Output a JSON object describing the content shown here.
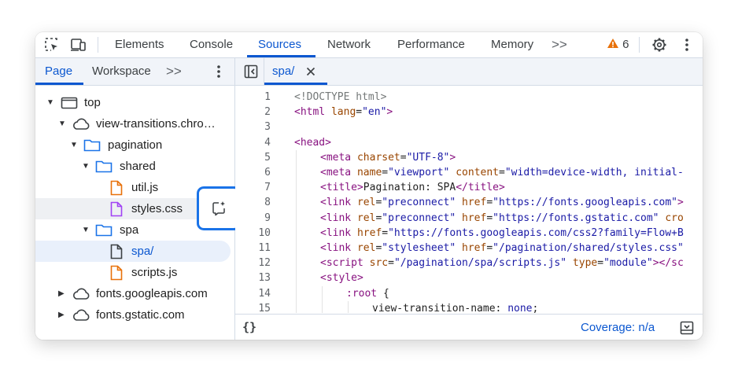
{
  "toolbar": {
    "tabs": [
      "Elements",
      "Console",
      "Sources",
      "Network",
      "Performance",
      "Memory"
    ],
    "active_tab": "Sources",
    "more_tabs_icon": ">>",
    "warning_count": "6"
  },
  "navigator": {
    "tabs": [
      "Page",
      "Workspace"
    ],
    "active_tab": "Page",
    "more_icon": ">>",
    "tree": [
      {
        "label": "top",
        "icon": "frame-icon",
        "expanded": true
      },
      {
        "label": "view-transitions.chro…",
        "icon": "cloud-icon",
        "expanded": true
      },
      {
        "label": "pagination",
        "icon": "folder-icon",
        "expanded": true
      },
      {
        "label": "shared",
        "icon": "folder-icon",
        "expanded": true
      },
      {
        "label": "util.js",
        "icon": "js-file-icon"
      },
      {
        "label": "styles.css",
        "icon": "css-file-icon"
      },
      {
        "label": "spa",
        "icon": "folder-icon",
        "expanded": true
      },
      {
        "label": "spa/",
        "icon": "document-file-icon",
        "selected": true
      },
      {
        "label": "scripts.js",
        "icon": "js-file-icon"
      },
      {
        "label": "fonts.googleapis.com",
        "icon": "cloud-icon",
        "expanded": false
      },
      {
        "label": "fonts.gstatic.com",
        "icon": "cloud-icon",
        "expanded": false
      }
    ]
  },
  "editor": {
    "open_tab": "spa/",
    "line_numbers": [
      "1",
      "2",
      "3",
      "4",
      "5",
      "6",
      "7",
      "8",
      "9",
      "10",
      "11",
      "12",
      "13",
      "14",
      "15"
    ],
    "lines": [
      [
        [
          "com",
          "<!DOCTYPE html>"
        ]
      ],
      [
        [
          "tag",
          "<html "
        ],
        [
          "attr",
          "lang"
        ],
        [
          "txt",
          "="
        ],
        [
          "val",
          "\"en\""
        ],
        [
          "tag",
          ">"
        ]
      ],
      [],
      [
        [
          "tag",
          "<head>"
        ]
      ],
      [
        [
          "tag",
          "<meta "
        ],
        [
          "attr",
          "charset"
        ],
        [
          "txt",
          "="
        ],
        [
          "val",
          "\"UTF-8\""
        ],
        [
          "tag",
          ">"
        ]
      ],
      [
        [
          "tag",
          "<meta "
        ],
        [
          "attr",
          "name"
        ],
        [
          "txt",
          "="
        ],
        [
          "val",
          "\"viewport\""
        ],
        [
          "txt",
          " "
        ],
        [
          "attr",
          "content"
        ],
        [
          "txt",
          "="
        ],
        [
          "val",
          "\"width=device-width, initial-"
        ]
      ],
      [
        [
          "tag",
          "<title>"
        ],
        [
          "txt",
          "Pagination: SPA"
        ],
        [
          "tag",
          "</title>"
        ]
      ],
      [
        [
          "tag",
          "<link "
        ],
        [
          "attr",
          "rel"
        ],
        [
          "txt",
          "="
        ],
        [
          "val",
          "\"preconnect\""
        ],
        [
          "txt",
          " "
        ],
        [
          "attr",
          "href"
        ],
        [
          "txt",
          "="
        ],
        [
          "val",
          "\"https://fonts.googleapis.com\""
        ],
        [
          "tag",
          ">"
        ]
      ],
      [
        [
          "tag",
          "<link "
        ],
        [
          "attr",
          "rel"
        ],
        [
          "txt",
          "="
        ],
        [
          "val",
          "\"preconnect\""
        ],
        [
          "txt",
          " "
        ],
        [
          "attr",
          "href"
        ],
        [
          "txt",
          "="
        ],
        [
          "val",
          "\"https://fonts.gstatic.com\""
        ],
        [
          "txt",
          " "
        ],
        [
          "attr",
          "cro"
        ]
      ],
      [
        [
          "tag",
          "<link "
        ],
        [
          "attr",
          "href"
        ],
        [
          "txt",
          "="
        ],
        [
          "val",
          "\"https://fonts.googleapis.com/css2?family=Flow+B"
        ]
      ],
      [
        [
          "tag",
          "<link "
        ],
        [
          "attr",
          "rel"
        ],
        [
          "txt",
          "="
        ],
        [
          "val",
          "\"stylesheet\""
        ],
        [
          "txt",
          " "
        ],
        [
          "attr",
          "href"
        ],
        [
          "txt",
          "="
        ],
        [
          "val",
          "\"/pagination/shared/styles.css\""
        ]
      ],
      [
        [
          "tag",
          "<script "
        ],
        [
          "attr",
          "src"
        ],
        [
          "txt",
          "="
        ],
        [
          "val",
          "\"/pagination/spa/scripts.js\""
        ],
        [
          "txt",
          " "
        ],
        [
          "attr",
          "type"
        ],
        [
          "txt",
          "="
        ],
        [
          "val",
          "\"module\""
        ],
        [
          "tag",
          "></sc"
        ]
      ],
      [
        [
          "tag",
          "<style>"
        ]
      ],
      [
        [
          "sel",
          ":root"
        ],
        [
          "txt",
          " {"
        ]
      ],
      [
        [
          "prop",
          "view-transition-name"
        ],
        [
          "txt",
          ": "
        ],
        [
          "kw",
          "none"
        ],
        [
          "txt",
          ";"
        ]
      ]
    ],
    "indent_levels": [
      0,
      0,
      0,
      0,
      1,
      1,
      1,
      1,
      1,
      1,
      1,
      1,
      1,
      2,
      3
    ]
  },
  "status": {
    "format_icon": "{}",
    "coverage": "Coverage: n/a"
  },
  "colors": {
    "accent": "#0b57d0",
    "warning": "#e8710a",
    "js_file": "#e8710a",
    "css_file": "#a142f4",
    "folder": "#1a73e8",
    "highlight_border": "#1a73e8"
  }
}
